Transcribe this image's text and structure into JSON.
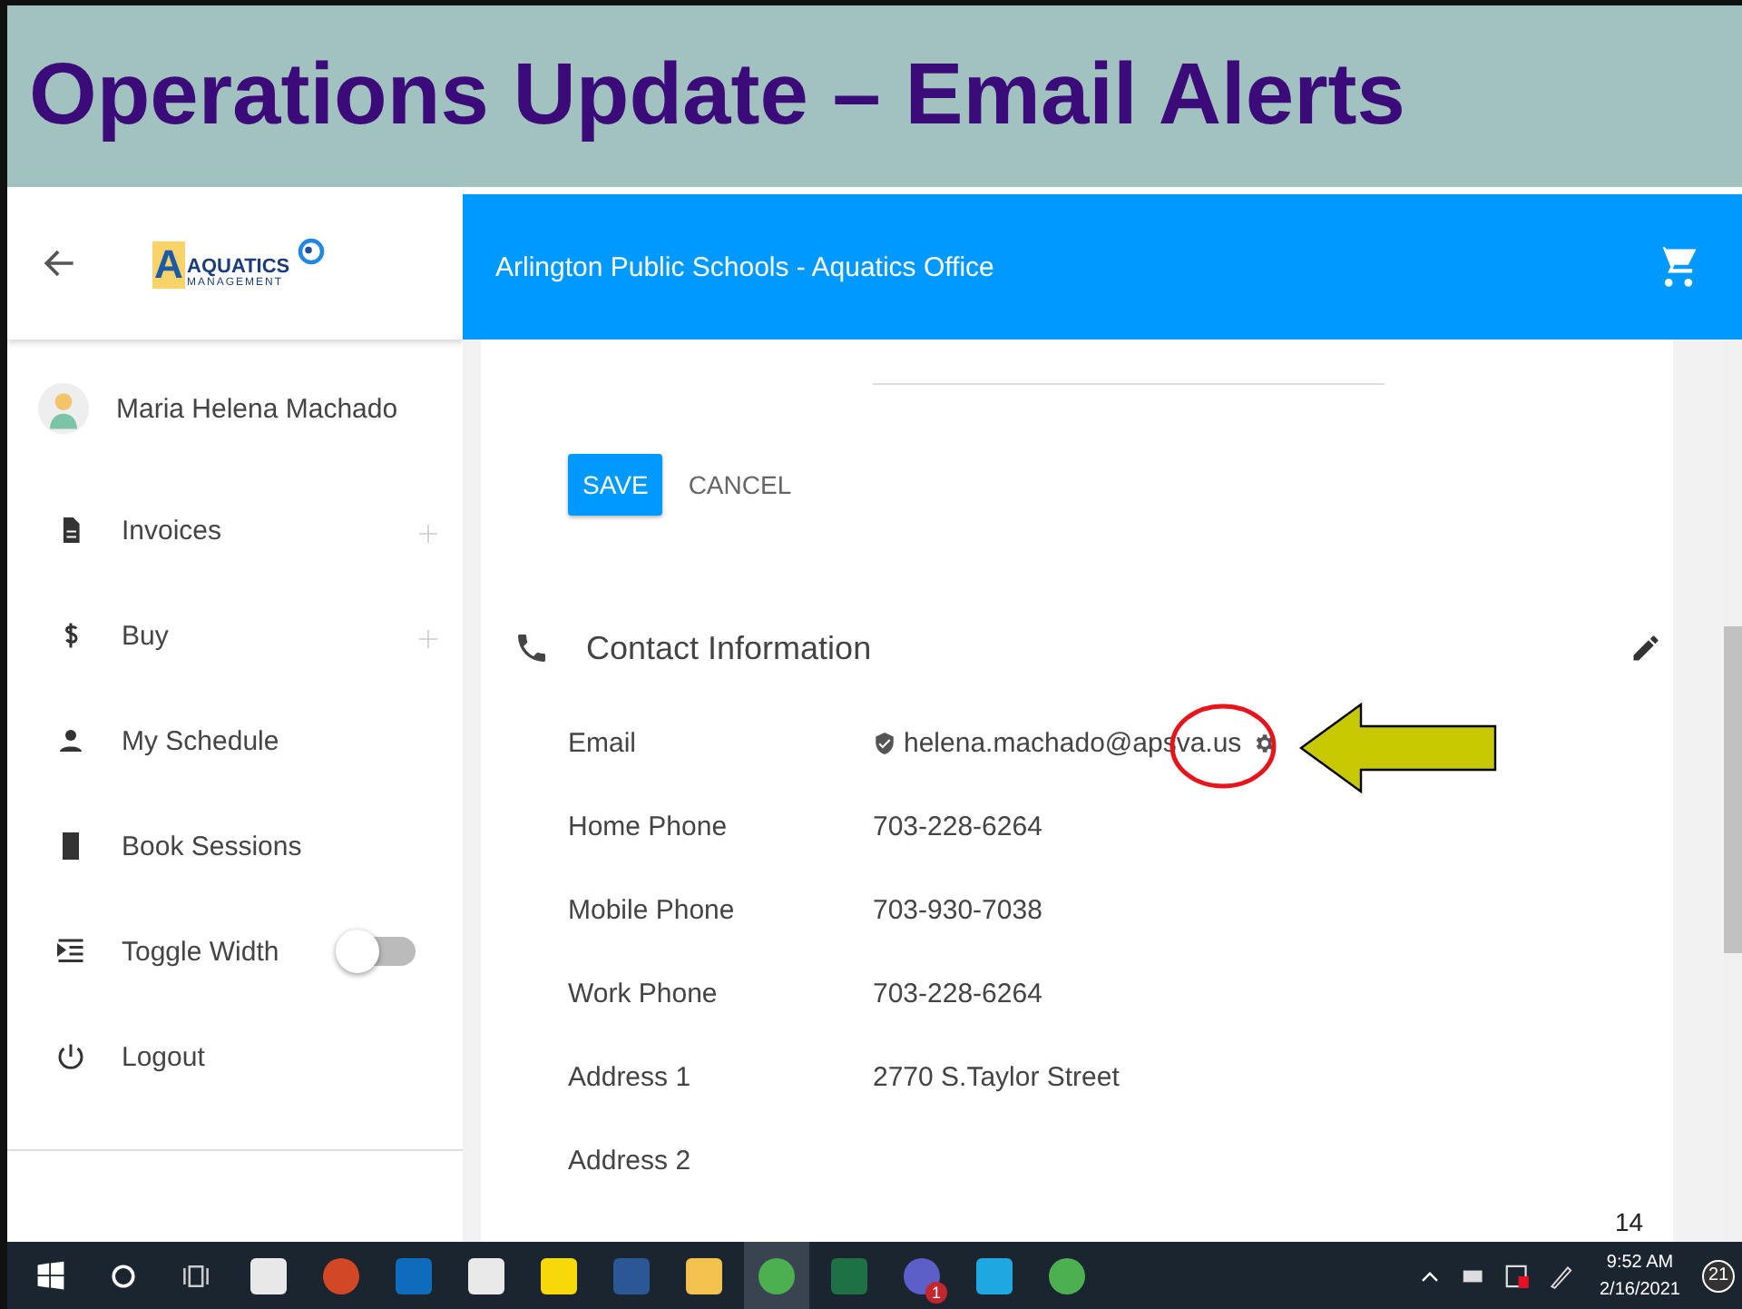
{
  "slide": {
    "title": "Operations Update – Email Alerts",
    "page_number": "14"
  },
  "sidebar": {
    "logo": {
      "letter": "A",
      "word": "AQUATICS",
      "subtitle": "MANAGEMENT"
    },
    "profile": {
      "name": "Maria Helena Machado"
    },
    "items": [
      {
        "kind": "document",
        "label": "Invoices",
        "expandable": true
      },
      {
        "kind": "dollar",
        "label": "Buy",
        "expandable": true
      },
      {
        "kind": "person",
        "label": "My Schedule",
        "expandable": false
      },
      {
        "kind": "book",
        "label": "Book Sessions",
        "expandable": false
      },
      {
        "kind": "indent",
        "label": "Toggle Width",
        "expandable": false,
        "toggle": {
          "on": false
        }
      },
      {
        "kind": "power",
        "label": "Logout",
        "expandable": false
      }
    ]
  },
  "header": {
    "title": "Arlington Public Schools - Aquatics Office"
  },
  "form": {
    "buttons": [
      {
        "label": "SAVE",
        "primary": true
      },
      {
        "label": "CANCEL",
        "primary": false
      }
    ]
  },
  "contact": {
    "title": "Contact Information",
    "fields": [
      {
        "label": "Email",
        "value": "helena.machado@apsva.us",
        "verified": true,
        "settings": true
      },
      {
        "label": "Home Phone",
        "value": "703-228-6264",
        "verified": false,
        "settings": false
      },
      {
        "label": "Mobile Phone",
        "value": "703-930-7038",
        "verified": false,
        "settings": false
      },
      {
        "label": "Work Phone",
        "value": "703-228-6264",
        "verified": false,
        "settings": false
      },
      {
        "label": "Address 1",
        "value": "2770 S.Taylor Street",
        "verified": false,
        "settings": false
      },
      {
        "label": "Address 2",
        "verified": false,
        "settings": false
      }
    ]
  },
  "taskbar": {
    "apps": [
      {
        "kind": "acrobat",
        "active": false
      },
      {
        "kind": "powerpoint",
        "active": false
      },
      {
        "kind": "outlook",
        "active": false
      },
      {
        "kind": "calculator",
        "active": false
      },
      {
        "kind": "notes",
        "active": false
      },
      {
        "kind": "word",
        "active": false
      },
      {
        "kind": "explorer",
        "active": false
      },
      {
        "kind": "chrome",
        "active": true
      },
      {
        "kind": "excel",
        "active": false
      },
      {
        "kind": "teams",
        "badge": "1",
        "active": false
      },
      {
        "kind": "ie",
        "active": false
      },
      {
        "kind": "chrome",
        "active": false
      }
    ],
    "time": "9:52 AM",
    "date": "2/16/2021",
    "notifications": "21"
  }
}
